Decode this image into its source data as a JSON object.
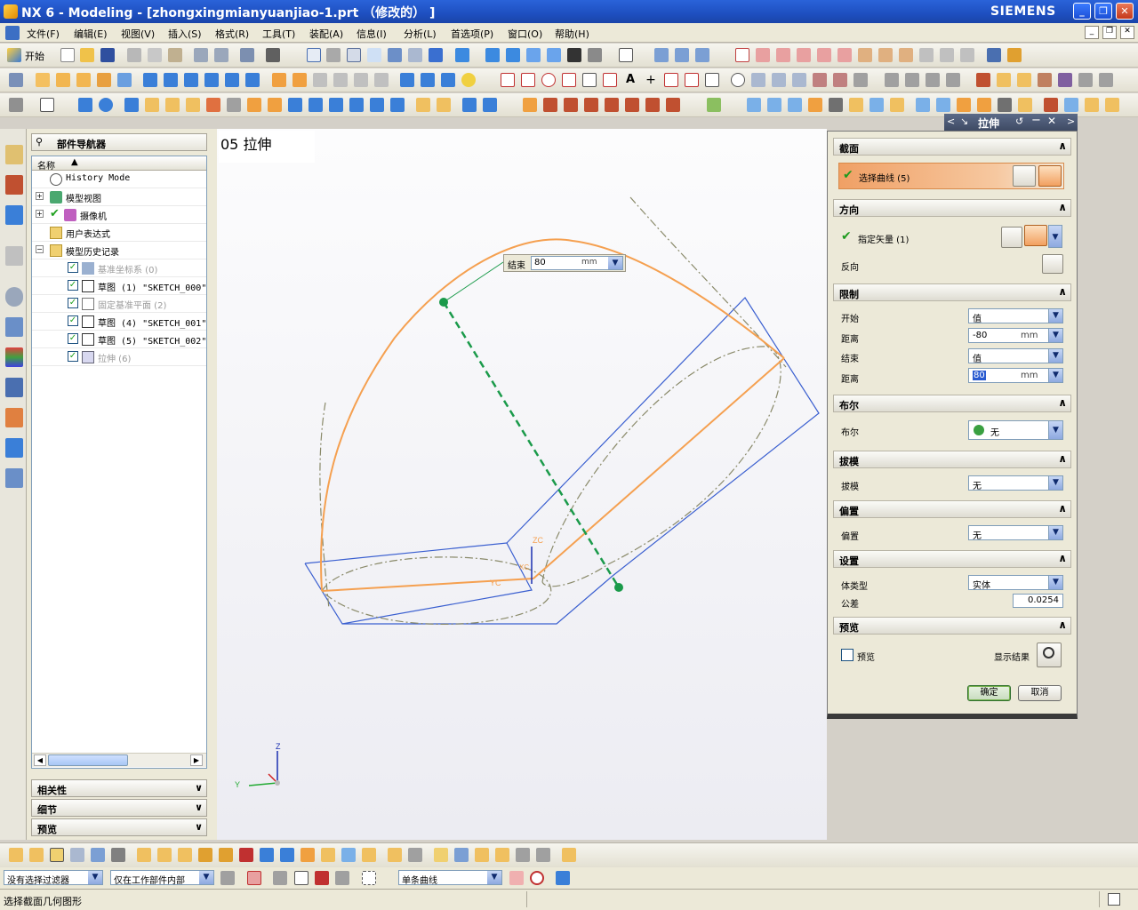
{
  "window": {
    "title": "NX 6 - Modeling - [zhongxingmianyuanjiao-1.prt （修改的） ]",
    "brand": "SIEMENS"
  },
  "menu": [
    "文件(F)",
    "编辑(E)",
    "视图(V)",
    "插入(S)",
    "格式(R)",
    "工具(T)",
    "装配(A)",
    "信息(I)",
    "分析(L)",
    "首选项(P)",
    "窗口(O)",
    "帮助(H)"
  ],
  "toolbar": {
    "start_label": "开始"
  },
  "part_navigator": {
    "title": "部件导航器",
    "column_name": "名称",
    "items": [
      {
        "label": "History Mode",
        "muted": false
      },
      {
        "label": "模型视图",
        "muted": false
      },
      {
        "label": "摄像机",
        "muted": false
      },
      {
        "label": "用户表达式",
        "muted": false
      },
      {
        "label": "模型历史记录",
        "muted": false
      },
      {
        "label": "基准坐标系 (0)",
        "muted": true
      },
      {
        "label": "草图 (1) \"SKETCH_000\"",
        "muted": false
      },
      {
        "label": "固定基准平面 (2)",
        "muted": true
      },
      {
        "label": "草图 (4) \"SKETCH_001\"",
        "muted": false
      },
      {
        "label": "草图 (5) \"SKETCH_002\"",
        "muted": false
      },
      {
        "label": "拉伸 (6)",
        "muted": true
      }
    ],
    "panels": [
      "相关性",
      "细节",
      "预览"
    ]
  },
  "viewport": {
    "label": "05 拉伸",
    "end_label": "结束",
    "end_value": "80",
    "end_unit": "mm",
    "triad": {
      "zc": "ZC",
      "yc": "YC",
      "xc": "XC",
      "z": "Z",
      "y": "Y"
    },
    "colors": {
      "outline": "#3a5fd0",
      "profile": "#f5a050",
      "guide": "#8a8a6a",
      "handle": "#1a9a4a"
    }
  },
  "extrude_dialog": {
    "title": "拉伸",
    "section": {
      "header": "截面",
      "select_curve": "选择曲线 (5)"
    },
    "direction": {
      "header": "方向",
      "specify_vector": "指定矢量 (1)",
      "reverse": "反向"
    },
    "limits": {
      "header": "限制",
      "start_label": "开始",
      "start_value": "值",
      "start_distance_label": "距离",
      "start_distance": "-80",
      "end_label": "结束",
      "end_value": "值",
      "end_distance_label": "距离",
      "end_distance": "80",
      "unit": "mm"
    },
    "boolean": {
      "header": "布尔",
      "label": "布尔",
      "value": "无"
    },
    "draft": {
      "header": "拔模",
      "label": "拔模",
      "value": "无"
    },
    "offset": {
      "header": "偏置",
      "label": "偏置",
      "value": "无"
    },
    "settings": {
      "header": "设置",
      "body_type_label": "体类型",
      "body_type": "实体",
      "tolerance_label": "公差",
      "tolerance": "0.0254"
    },
    "preview": {
      "header": "预览",
      "preview_label": "预览",
      "show_result": "显示结果"
    },
    "ok": "确定",
    "cancel": "取消"
  },
  "filter_bar": {
    "type_filter": "没有选择过滤器",
    "scope": "仅在工作部件内部",
    "curve_rule": "单条曲线"
  },
  "status": {
    "prompt": "选择截面几何图形"
  }
}
